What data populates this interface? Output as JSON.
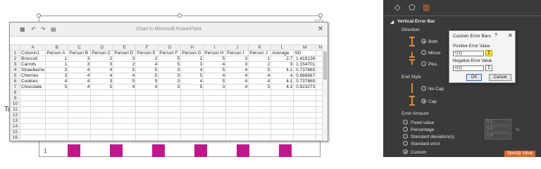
{
  "slide": {
    "left_text": "Ta",
    "axis_label": "1"
  },
  "spreadsheet": {
    "title": "Chart in Microsoft PowerPoint",
    "close_glyph": "✕",
    "column_letters": [
      "A",
      "B",
      "C",
      "D",
      "E",
      "F",
      "G",
      "H",
      "I",
      "J",
      "K",
      "L",
      "M",
      "N"
    ],
    "rows": [
      [
        "Column1",
        "Person A",
        "Person B",
        "Person C",
        "Person D",
        "Person E",
        "Person F",
        "Person G",
        "Person H",
        "Person I",
        "Person J",
        "Average",
        "SD",
        ""
      ],
      [
        "Broccoli",
        "1",
        "3",
        "2",
        "3",
        "2",
        "5",
        "2",
        "5",
        "3",
        "1",
        "2.7",
        "1.418136",
        ""
      ],
      [
        "Carrots",
        "1",
        "3",
        "3",
        "2",
        "4",
        "5",
        "3",
        "4",
        "3",
        "2",
        "3",
        "1.154701",
        ""
      ],
      [
        "Strawberrie",
        "3",
        "4",
        "4",
        "5",
        "5",
        "3",
        "4",
        "5",
        "4",
        "5",
        "4.1",
        "0.737865",
        ""
      ],
      [
        "Cherries",
        "3",
        "4",
        "4",
        "4",
        "5",
        "3",
        "5",
        "4",
        "4",
        "4",
        "4",
        "0.666667",
        ""
      ],
      [
        "Cookies",
        "4",
        "4",
        "3",
        "5",
        "5",
        "3",
        "4",
        "5",
        "4",
        "4",
        "4.1",
        "0.737865",
        ""
      ],
      [
        "Chocolate",
        "5",
        "4",
        "5",
        "4",
        "4",
        "3",
        "5",
        "3",
        "4",
        "5",
        "4.3",
        "0.823273",
        ""
      ],
      [
        "",
        "",
        "",
        "",
        "",
        "",
        "",
        "",
        "",
        "",
        "",
        "",
        "",
        ""
      ],
      [
        "",
        "",
        "",
        "",
        "",
        "",
        "",
        "",
        "",
        "",
        "",
        "",
        "",
        ""
      ],
      [
        "",
        "",
        "",
        "",
        "",
        "",
        "",
        "",
        "",
        "",
        "",
        "",
        "",
        ""
      ],
      [
        "",
        "",
        "",
        "",
        "",
        "",
        "",
        "",
        "",
        "",
        "",
        "",
        "",
        ""
      ],
      [
        "",
        "",
        "",
        "",
        "",
        "",
        "",
        "",
        "",
        "",
        "",
        "",
        "",
        ""
      ],
      [
        "",
        "",
        "",
        "",
        "",
        "",
        "",
        "",
        "",
        "",
        "",
        "",
        "",
        ""
      ],
      [
        "",
        "",
        "",
        "",
        "",
        "",
        "",
        "",
        "",
        "",
        "",
        "",
        "",
        ""
      ],
      [
        "",
        "",
        "",
        "",
        "",
        "",
        "",
        "",
        "",
        "",
        "",
        "",
        "",
        ""
      ],
      [
        "",
        "",
        "",
        "",
        "",
        "",
        "",
        "",
        "",
        "",
        "",
        "",
        "",
        ""
      ],
      [
        "",
        "",
        "",
        "",
        "",
        "",
        "",
        "",
        "",
        "",
        "",
        "",
        "",
        ""
      ],
      [
        "",
        "",
        "",
        "",
        "",
        "",
        "",
        "",
        "",
        "",
        "",
        "",
        "",
        ""
      ]
    ]
  },
  "pane": {
    "section_title": "Vertical Error Bar",
    "direction_label": "Direction",
    "directions": [
      "Both",
      "Minus",
      "Plus"
    ],
    "end_style_label": "End Style",
    "end_styles": [
      "No Cap",
      "Cap"
    ],
    "error_amount_label": "Error Amount",
    "amounts": [
      "Fixed value",
      "Percentage",
      "Standard deviation(s)",
      "Standard error",
      "Custom"
    ],
    "fixed_value": "0.1",
    "percentage_value": "5.0",
    "stddev_value": "1.0",
    "percent_sign": "%",
    "specify_button": "Specify Value",
    "accent": "#d86b2a"
  },
  "dialog": {
    "title": "Custom Error Bars",
    "help_glyph": "?",
    "close_glyph": "✕",
    "positive_label": "Positive Error Value",
    "positive_value": "={1}",
    "negative_label": "Negative Error Value",
    "negative_value": "={1}",
    "ok": "OK",
    "cancel": "Cancel",
    "highlight": "#f3ec1a"
  }
}
